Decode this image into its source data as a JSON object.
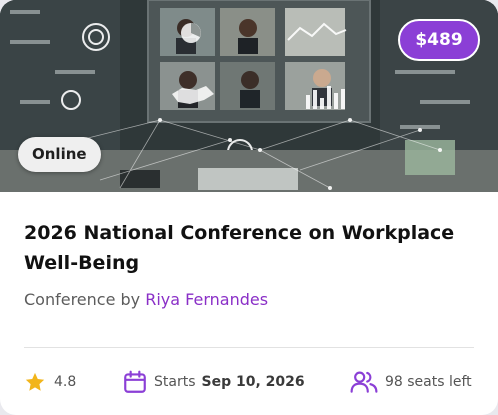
{
  "event": {
    "badge_mode": "Online",
    "price": "$489",
    "title": "2026 National Conference on Workplace Well-Being",
    "type_prefix": "Conference by",
    "organizer": "Riya Fernandes"
  },
  "meta": {
    "rating": "4.8",
    "starts_label": "Starts",
    "starts_date": "Sep 10, 2026",
    "seats": "98 seats left"
  },
  "colors": {
    "accent": "#8b3fd6",
    "organizer_link": "#8a2fc7",
    "star": "#f2b51b"
  },
  "icons": {
    "rating": "star-icon",
    "date": "calendar-icon",
    "seats": "users-icon"
  }
}
